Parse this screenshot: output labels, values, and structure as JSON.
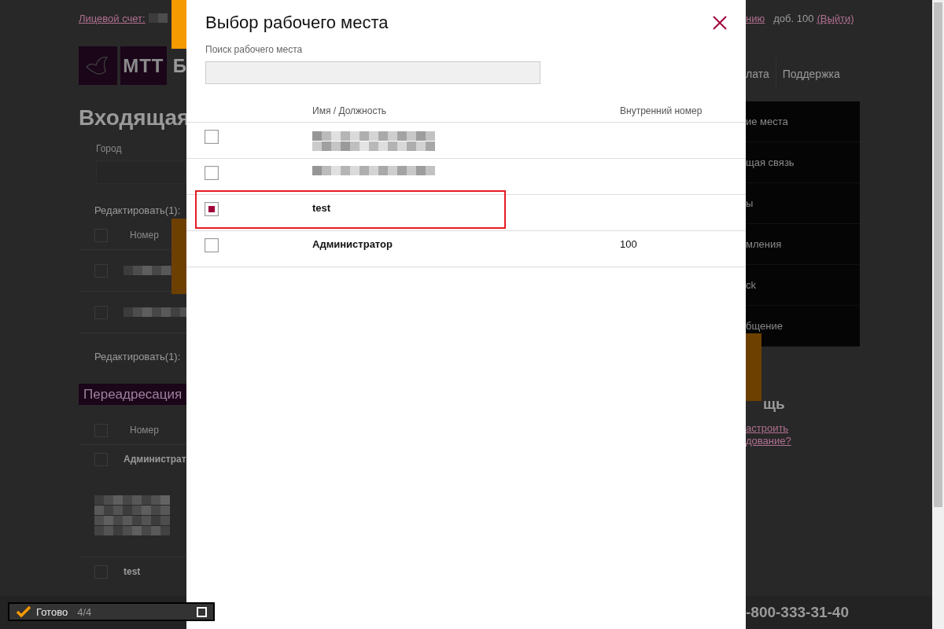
{
  "background_page": {
    "account_link": "Лицевой счет:",
    "logo_text": "МТТ",
    "brand_fragment": "Б",
    "heading": "Входящая",
    "city_label": "Город",
    "edit_label_top": "Редактировать(1):",
    "table_top": {
      "header": "Номер",
      "select_all_checked": false,
      "rows": [
        {
          "kind": "redacted",
          "checked": false
        },
        {
          "kind": "redacted",
          "checked": false
        }
      ]
    },
    "edit_label_bottom": "Редактировать(1):",
    "section_title": "Переадресация",
    "table_bottom": {
      "header": "Номер",
      "select_all_checked": false,
      "rows": [
        {
          "kind": "text",
          "name": "Администрат",
          "checked": false
        },
        {
          "kind": "redacted-block"
        },
        {
          "kind": "text",
          "name": "test",
          "checked": false
        }
      ]
    },
    "settings_link": "нию",
    "extension": "доб. 100",
    "logout_link": "(Выйти)",
    "nav": [
      "лата",
      "Поддержка"
    ],
    "menu": [
      "ие места",
      "щая связь",
      "ы",
      "мления",
      "ck",
      "бщение"
    ],
    "help_title": "щь",
    "help_link_lines": [
      "астроить",
      "дование?"
    ],
    "footer_phone": "-800-333-31-40"
  },
  "modal": {
    "title": "Выбор рабочего места",
    "search_label": "Поиск рабочего места",
    "columns": [
      "Имя / Должность",
      "Внутренний номер"
    ],
    "rows": [
      {
        "kind": "redacted-double",
        "checked": false,
        "highlighted": false
      },
      {
        "kind": "redacted-single",
        "checked": false,
        "highlighted": false
      },
      {
        "kind": "text",
        "name": "test",
        "checked": true,
        "highlighted": true
      },
      {
        "kind": "text",
        "name": "Администратор",
        "extension": "100",
        "checked": false,
        "highlighted": false
      }
    ]
  },
  "status_widget": {
    "label": "Готово",
    "count": "4/4"
  }
}
